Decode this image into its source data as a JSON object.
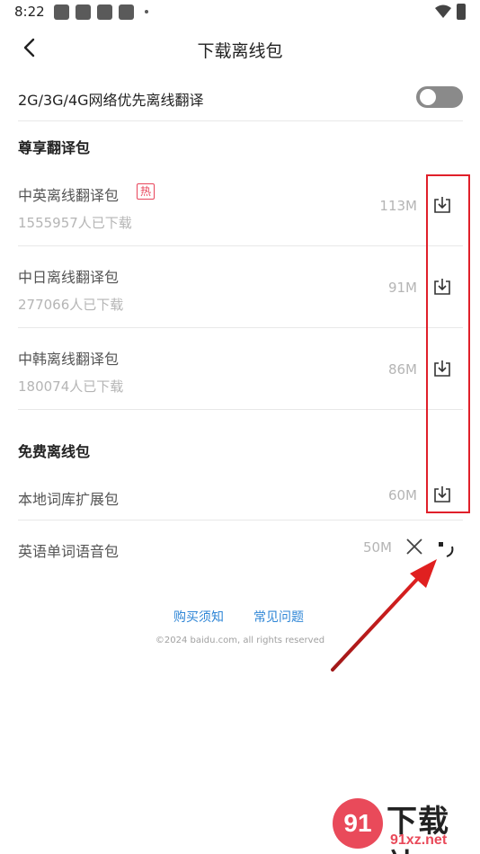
{
  "status_bar": {
    "time": "8:22"
  },
  "header": {
    "title": "下载离线包"
  },
  "settings": {
    "toggle_label": "2G/3G/4G网络优先离线翻译",
    "toggle_on": false
  },
  "premium_section": {
    "title": "尊享翻译包",
    "items": [
      {
        "name": "中英离线翻译包",
        "badge": "热",
        "downloads": "1555957人已下载",
        "size": "113M"
      },
      {
        "name": "中日离线翻译包",
        "downloads": "277066人已下载",
        "size": "91M"
      },
      {
        "name": "中韩离线翻译包",
        "downloads": "180074人已下载",
        "size": "86M"
      }
    ]
  },
  "free_section": {
    "title": "免费离线包",
    "items": [
      {
        "name": "本地词库扩展包",
        "size": "60M"
      },
      {
        "name": "英语单词语音包",
        "size": "50M"
      }
    ]
  },
  "footer": {
    "links": [
      "购买须知",
      "常见问题"
    ],
    "copyright": "©2024 baidu.com, all rights reserved"
  },
  "watermark": {
    "text": "下载站",
    "url": "91xz.net",
    "logo": "91"
  },
  "colors": {
    "highlight_box": "#e0202a",
    "link": "#2f86d6",
    "hot_badge": "#e8445a"
  }
}
